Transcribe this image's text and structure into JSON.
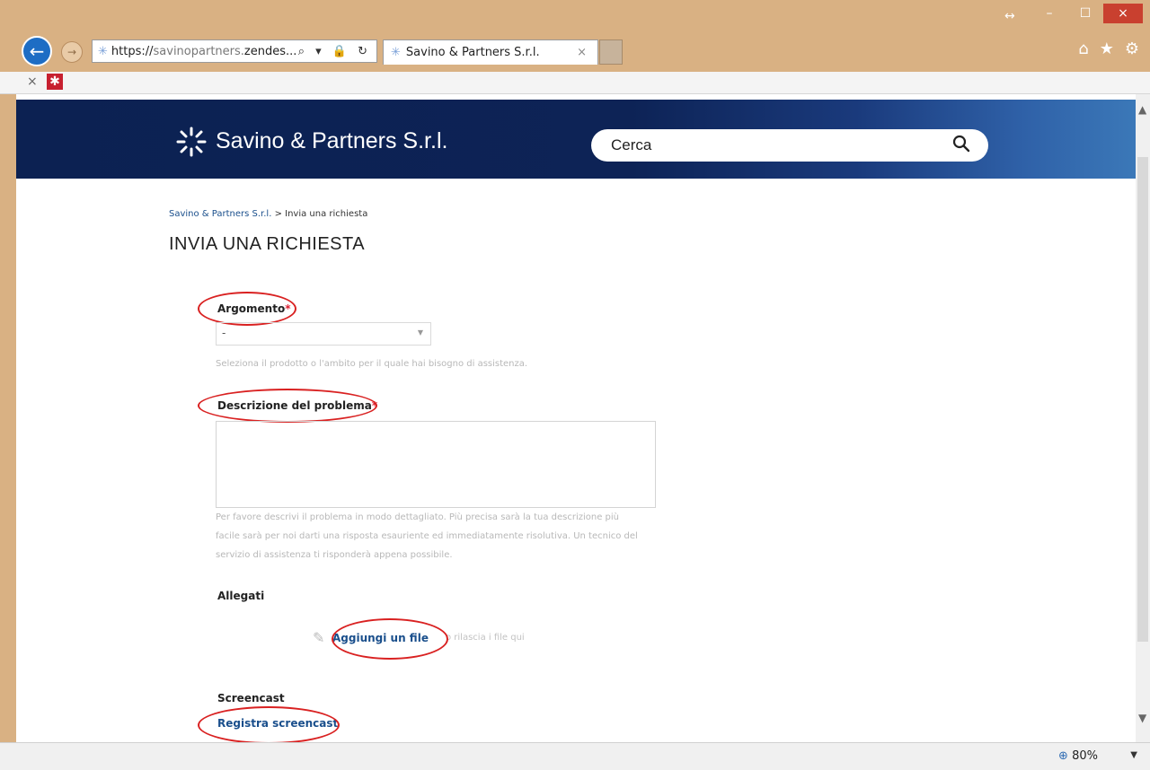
{
  "browser": {
    "url_scheme": "https://",
    "url_host_faint": "savinopartners.",
    "url_host_bold": "zendes...",
    "address_tools": "⌕ ▾ 🔒 ↻",
    "tab_title": "Savino & Partners S.r.l.",
    "tab_close": "×",
    "zoom": "80%",
    "window_controls": {
      "minimize": "–",
      "maximize": "☐",
      "close": "×",
      "resize": "↔"
    },
    "command_icons": {
      "home": "⌂",
      "favorites": "★",
      "tools": "⚙"
    },
    "favbar_close": "×",
    "favbar_icon": "✱"
  },
  "site": {
    "name": "Savino & Partners S.r.l.",
    "search_placeholder": "Cerca",
    "search_icon": "search-icon"
  },
  "breadcrumb": {
    "home": "Savino & Partners S.r.l.",
    "separator": ">",
    "current": "Invia una richiesta"
  },
  "page_title": "INVIA UNA RICHIESTA",
  "form": {
    "subject_label": "Argomento",
    "required_mark": "*",
    "subject_value": "-",
    "subject_hint": "Seleziona il prodotto o l'ambito per il quale hai bisogno di assistenza.",
    "description_label": "Descrizione del problema",
    "description_hint_1": "Per favore descrivi il problema in modo dettagliato. Più precisa sarà la tua descrizione più",
    "description_hint_2": "facile sarà per noi darti una risposta esauriente ed immediatamente risolutiva. Un tecnico del",
    "description_hint_3": "servizio di assistenza ti risponderà appena possibile.",
    "attachments_label": "Allegati",
    "add_file": "Aggiungi un file",
    "drop_hint": "o rilascia i file qui",
    "screencast_label": "Screencast",
    "record_screencast": "Registra screencast"
  },
  "annotation_color": "#d92121",
  "header_colors": {
    "dark": "#0c2152",
    "light": "#3b78b8"
  }
}
